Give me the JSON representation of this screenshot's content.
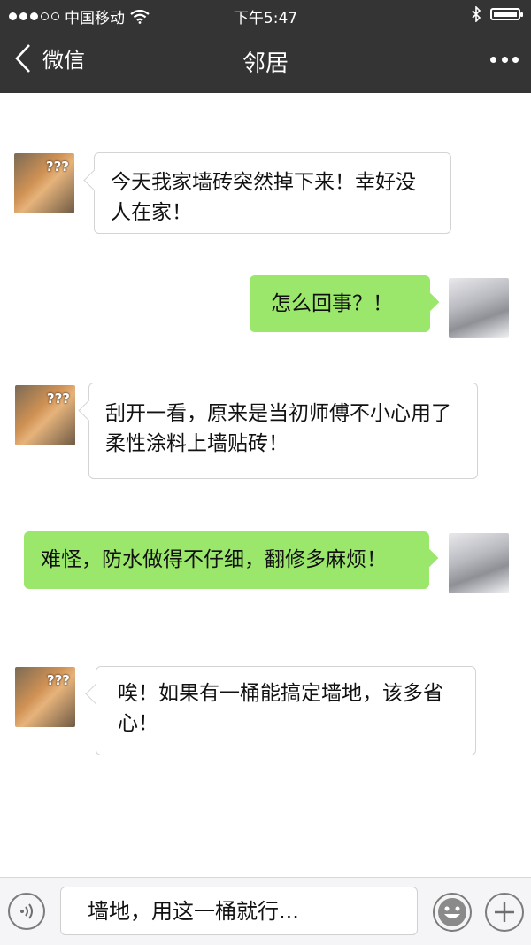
{
  "status_bar": {
    "carrier": "中国移动",
    "time": "下午5:47",
    "signal_dots_filled": 3,
    "signal_dots_total": 5
  },
  "nav": {
    "back_label": "微信",
    "title": "邻居"
  },
  "messages": [
    {
      "side": "left",
      "avatar": "dog-avatar",
      "text": "今天我家墙砖突然掉下来！幸好没人在家！"
    },
    {
      "side": "right",
      "avatar": "cat-avatar",
      "text": "怎么回事？！"
    },
    {
      "side": "left",
      "avatar": "dog-avatar",
      "text": "刮开一看，原来是当初师傅不小心用了柔性涂料上墙贴砖！"
    },
    {
      "side": "right",
      "avatar": "cat-avatar",
      "text": "难怪，防水做得不仔细，翻修多麻烦！"
    },
    {
      "side": "left",
      "avatar": "dog-avatar",
      "text": "唉！如果有一桶能搞定墙地，该多省心！"
    }
  ],
  "avatar_overlay_text": "???",
  "input_bar": {
    "value": "墙地，用这一桶就行..."
  },
  "colors": {
    "header_bg": "#343434",
    "outgoing_bubble": "#9be76b",
    "incoming_bubble": "#ffffff"
  }
}
